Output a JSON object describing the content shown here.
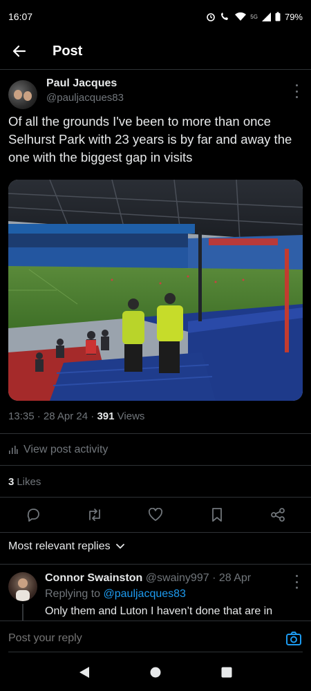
{
  "status_bar": {
    "time": "16:07",
    "network": "5G",
    "battery": "79%",
    "icons": [
      "alarm-icon",
      "wifi-call-icon",
      "wifi-icon",
      "signal-icon",
      "battery-icon"
    ]
  },
  "header": {
    "title": "Post",
    "back_icon": "arrow-left-icon"
  },
  "post": {
    "author_name": "Paul Jacques",
    "author_handle": "@pauljacques83",
    "text": "Of all the grounds I've been to more than once Selhurst Park with 23 years is by far and away the one with the biggest gap in visits",
    "media_description_icon": "stadium-photo",
    "time": "13:35",
    "date": "28 Apr 24",
    "views_count": "391",
    "views_label": "Views",
    "sep": "·",
    "activity_label": "View post activity",
    "likes_count": "3",
    "likes_label": "Likes"
  },
  "actions": [
    {
      "name": "reply-icon"
    },
    {
      "name": "repost-icon"
    },
    {
      "name": "like-icon"
    },
    {
      "name": "bookmark-icon"
    },
    {
      "name": "share-icon"
    }
  ],
  "replies_section": {
    "sort_label": "Most relevant replies"
  },
  "reply": {
    "author_name": "Connor Swainston",
    "author_handle": "@swainy997",
    "date": "28 Apr",
    "sep": "·",
    "replying_to_label": "Replying to",
    "replying_to_handle": "@pauljacques83",
    "text": "Only them and Luton I haven’t done that are in"
  },
  "composer": {
    "placeholder": "Post your reply"
  },
  "colors": {
    "background": "#000000",
    "text_primary": "#e7e9ea",
    "text_secondary": "#71767b",
    "accent": "#1d9bf0",
    "divider": "#2f3336"
  }
}
